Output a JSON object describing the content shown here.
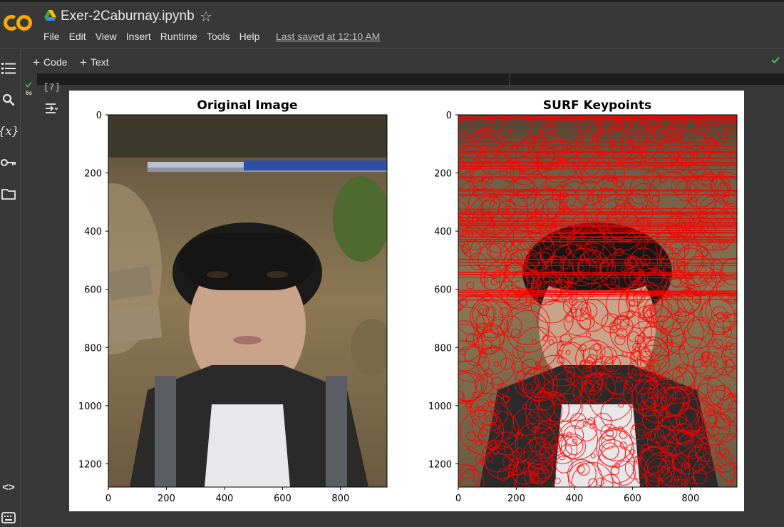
{
  "app": {
    "logo": "colab-logo",
    "notebook_title": "Exer-2Caburnay.ipynb",
    "last_saved": "Last saved at 12:10 AM"
  },
  "menu": [
    "File",
    "Edit",
    "View",
    "Insert",
    "Runtime",
    "Tools",
    "Help"
  ],
  "toolbar": {
    "code_label": "Code",
    "text_label": "Text"
  },
  "sidebar": {
    "icons": [
      "table-of-contents-icon",
      "search-icon",
      "variables-icon",
      "secrets-key-icon",
      "files-folder-icon",
      "code-snippets-icon",
      "terminal-icon"
    ]
  },
  "cell": {
    "exec_time": "6s",
    "exec_count": "[7]",
    "status_color": "#5cb85c"
  },
  "chart_data": [
    {
      "type": "image",
      "title": "Original Image",
      "xticks": [
        "0",
        "200",
        "400",
        "600",
        "800"
      ],
      "yticks": [
        "0",
        "200",
        "400",
        "600",
        "800",
        "1000",
        "1200"
      ],
      "xlim": [
        0,
        960
      ],
      "ylim": [
        1280,
        0
      ]
    },
    {
      "type": "image",
      "title": "SURF Keypoints",
      "xticks": [
        "0",
        "200",
        "400",
        "600",
        "800"
      ],
      "yticks": [
        "0",
        "200",
        "400",
        "600",
        "800",
        "1000",
        "1200"
      ],
      "xlim": [
        0,
        960
      ],
      "ylim": [
        1280,
        0
      ],
      "keypoint_color": "#ff0000"
    }
  ]
}
